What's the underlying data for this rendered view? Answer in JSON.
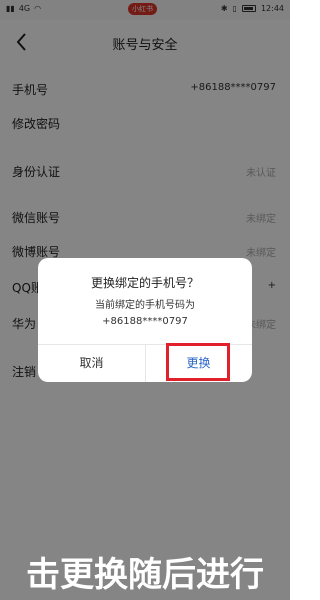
{
  "status_bar": {
    "carrier": "4G",
    "badge": "小红书",
    "time": "12:44"
  },
  "header": {
    "title": "账号与安全"
  },
  "rows": [
    {
      "label": "手机号",
      "value": "+86188****0797"
    },
    {
      "label": "修改密码",
      "value": ""
    },
    {
      "label": "身份认证",
      "value": "未认证"
    },
    {
      "label": "微信账号",
      "value": "未绑定"
    },
    {
      "label": "微博账号",
      "value": "未绑定"
    },
    {
      "label": "QQ账号",
      "value": "+"
    },
    {
      "label": "华为",
      "value": "未绑定"
    },
    {
      "label": "注销",
      "value": ""
    }
  ],
  "dialog": {
    "title": "更换绑定的手机号？",
    "message_line1": "当前绑定的手机号码为",
    "message_line2": "+86188****0797",
    "cancel_label": "取消",
    "confirm_label": "更换"
  },
  "caption": {
    "text": "击更换随后进行"
  },
  "colors": {
    "accent": "#2a66c9",
    "highlight": "#e0202a",
    "badge": "#e0352b"
  }
}
